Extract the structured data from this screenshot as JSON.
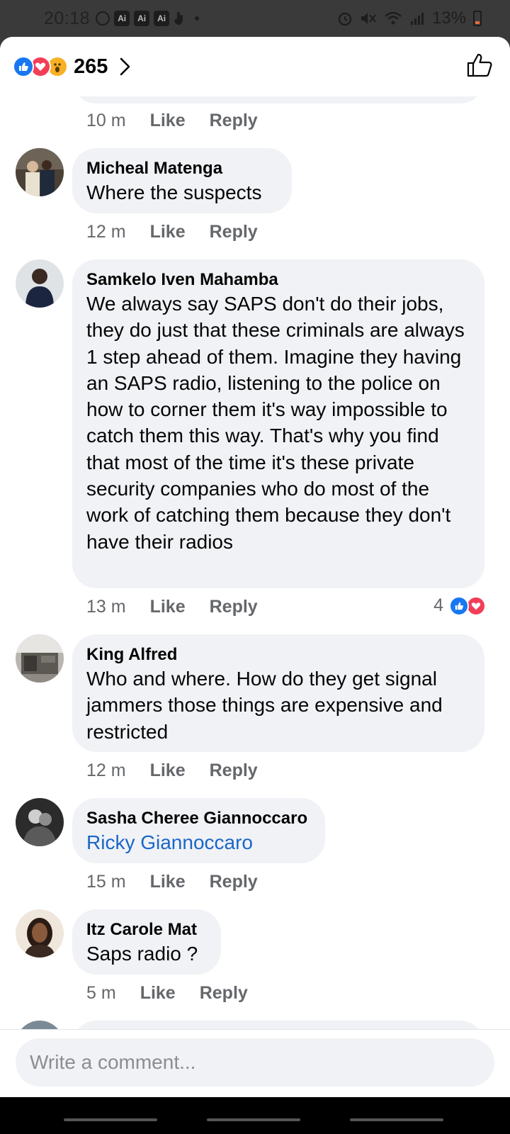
{
  "status_bar": {
    "time": "20:18",
    "ai_badges": [
      "Ai",
      "Ai",
      "Ai"
    ],
    "battery": "13%"
  },
  "header": {
    "reaction_count": "265",
    "reaction_icons": [
      "like-icon",
      "love-icon",
      "wow-icon"
    ]
  },
  "previous_comment": {
    "time": "10 m",
    "like": "Like",
    "reply": "Reply"
  },
  "comments": [
    {
      "author": "Micheal Matenga",
      "text": "Where the suspects",
      "time": "12 m",
      "like": "Like",
      "reply": "Reply"
    },
    {
      "author": "Samkelo Iven Mahamba",
      "text": "We always say SAPS don't do their jobs, they do just that these criminals are always 1 step ahead of them. Imagine they having an SAPS radio, listening to the police on how to corner them it's way impossible to catch them this way. That's why you find that most of the time it's these private security companies who do most of the work of catching them because they don't have their radios",
      "time": "13 m",
      "like": "Like",
      "reply": "Reply",
      "reaction_count": "4"
    },
    {
      "author": "King Alfred",
      "text": "Who and where. How do they get signal jammers those things are expensive and restricted",
      "time": "12 m",
      "like": "Like",
      "reply": "Reply"
    },
    {
      "author": "Sasha Cheree Giannoccaro",
      "text": "Ricky Giannoccaro",
      "time": "15 m",
      "like": "Like",
      "reply": "Reply"
    },
    {
      "author": "Itz Carole Mat",
      "text": "Saps radio ?",
      "time": "5 m",
      "like": "Like",
      "reply": "Reply"
    }
  ],
  "composer": {
    "placeholder": "Write a comment..."
  },
  "colors": {
    "like_blue": "#1877f2",
    "love_red": "#f33e58",
    "wow_yellow": "#f7b125",
    "bubble_bg": "#f0f2f5",
    "meta_gray": "#65676b",
    "mention_blue": "#1b66c9"
  }
}
